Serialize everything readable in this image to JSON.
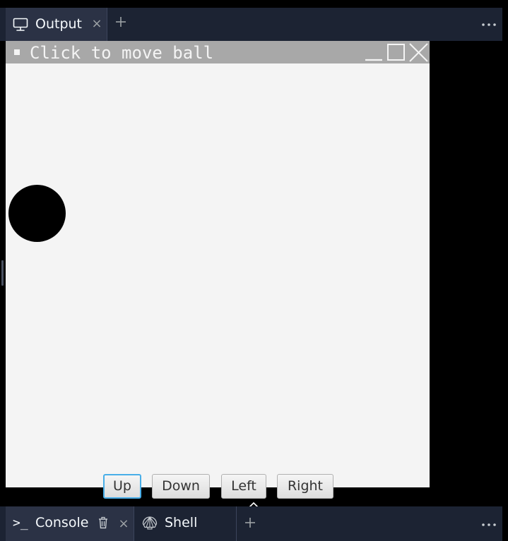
{
  "top_panel": {
    "tab": {
      "label": "Output",
      "icon": "monitor-icon",
      "close_glyph": "×"
    },
    "add_icon": "plus-icon",
    "more_icon": "ellipsis-icon"
  },
  "window": {
    "title": "Click to move ball",
    "controls": [
      "minimize-icon",
      "maximize-icon",
      "close-icon"
    ],
    "canvas_background": "#f4f4f4",
    "titlebar_color": "#a8a8a8",
    "ball_color": "#000000",
    "buttons": {
      "up": "Up",
      "down": "Down",
      "left": "Left",
      "right": "Right"
    },
    "focused_button": "up",
    "focus_color": "#48aee8"
  },
  "bottom_panel": {
    "tabs": [
      {
        "label": "Console",
        "icon": "terminal-prompt-icon",
        "prompt_glyph": ">_",
        "active": true
      },
      {
        "label": "Shell",
        "icon": "shell-icon",
        "active": false
      }
    ],
    "close_glyph": "×",
    "add_icon": "plus-icon",
    "more_icon": "ellipsis-icon"
  },
  "theme": {
    "tabbar_background": "#1c2333",
    "active_tab_background": "#2b3245",
    "tab_text": "#f5f9fc",
    "muted_icon": "#9da2a6"
  }
}
